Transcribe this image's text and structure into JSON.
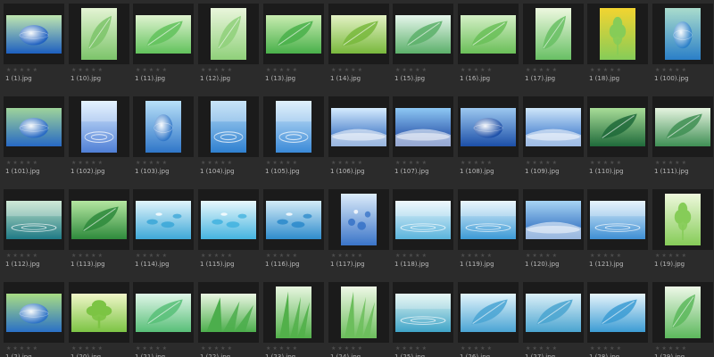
{
  "browser": {
    "thumbnails": [
      {
        "filename": "1 (1).jpg",
        "orientation": "landscape",
        "motif": "globe",
        "colors": [
          "#1d5fc0",
          "#bfe6b0"
        ]
      },
      {
        "filename": "1 (10).jpg",
        "orientation": "portrait",
        "motif": "leaf",
        "colors": [
          "#7cc46a",
          "#e4f4d4"
        ]
      },
      {
        "filename": "1 (11).jpg",
        "orientation": "landscape",
        "motif": "leaf",
        "colors": [
          "#62c25c",
          "#dff3d0"
        ]
      },
      {
        "filename": "1 (12).jpg",
        "orientation": "portrait",
        "motif": "leaf",
        "colors": [
          "#8fd07a",
          "#eaf6dc"
        ]
      },
      {
        "filename": "1 (13).jpg",
        "orientation": "landscape",
        "motif": "leaf",
        "colors": [
          "#49b04a",
          "#c8ecb0"
        ]
      },
      {
        "filename": "1 (14).jpg",
        "orientation": "landscape",
        "motif": "leaf",
        "colors": [
          "#78b83c",
          "#e3f2c4"
        ]
      },
      {
        "filename": "1 (15).jpg",
        "orientation": "landscape",
        "motif": "leaf",
        "colors": [
          "#5cb06a",
          "#e6f6ec"
        ]
      },
      {
        "filename": "1 (16).jpg",
        "orientation": "landscape",
        "motif": "leaf",
        "colors": [
          "#6abf58",
          "#d4efc6"
        ]
      },
      {
        "filename": "1 (17).jpg",
        "orientation": "portrait",
        "motif": "leaf",
        "colors": [
          "#68c064",
          "#eef8e0"
        ]
      },
      {
        "filename": "1 (18).jpg",
        "orientation": "portrait",
        "motif": "flower",
        "colors": [
          "#86cc58",
          "#f3d430"
        ]
      },
      {
        "filename": "1 (100).jpg",
        "orientation": "portrait",
        "motif": "globe",
        "colors": [
          "#2a7fc8",
          "#a9dccc"
        ]
      },
      {
        "filename": "1 (101).jpg",
        "orientation": "landscape",
        "motif": "globe",
        "colors": [
          "#2769c4",
          "#9ed39a"
        ]
      },
      {
        "filename": "1 (102).jpg",
        "orientation": "portrait",
        "motif": "water",
        "colors": [
          "#4f7fd6",
          "#dcefff"
        ]
      },
      {
        "filename": "1 (103).jpg",
        "orientation": "portrait",
        "motif": "globe",
        "colors": [
          "#2f76c8",
          "#b8e0f8"
        ]
      },
      {
        "filename": "1 (104).jpg",
        "orientation": "portrait",
        "motif": "water",
        "colors": [
          "#2f80d0",
          "#b6dcf6"
        ]
      },
      {
        "filename": "1 (105).jpg",
        "orientation": "portrait",
        "motif": "water",
        "colors": [
          "#3a8ad8",
          "#d6ecfb"
        ]
      },
      {
        "filename": "1 (106).jpg",
        "orientation": "landscape",
        "motif": "sky",
        "colors": [
          "#1f5db8",
          "#d6ecff"
        ]
      },
      {
        "filename": "1 (107).jpg",
        "orientation": "landscape",
        "motif": "sky",
        "colors": [
          "#153c9a",
          "#8ec8f4"
        ]
      },
      {
        "filename": "1 (108).jpg",
        "orientation": "landscape",
        "motif": "globe",
        "colors": [
          "#1c4fa8",
          "#9cc8f0"
        ]
      },
      {
        "filename": "1 (109).jpg",
        "orientation": "landscape",
        "motif": "sky",
        "colors": [
          "#2668c4",
          "#cfe6fa"
        ]
      },
      {
        "filename": "1 (110).jpg",
        "orientation": "landscape",
        "motif": "leaf",
        "colors": [
          "#1f6a3a",
          "#a8dc98"
        ]
      },
      {
        "filename": "1 (111).jpg",
        "orientation": "landscape",
        "motif": "leaf",
        "colors": [
          "#3f8f54",
          "#e6f4e0"
        ]
      },
      {
        "filename": "1 (112).jpg",
        "orientation": "landscape",
        "motif": "water",
        "colors": [
          "#1f7a86",
          "#bfe2c8"
        ]
      },
      {
        "filename": "1 (113).jpg",
        "orientation": "landscape",
        "motif": "leaf",
        "colors": [
          "#2e8a3c",
          "#b4e6a0"
        ]
      },
      {
        "filename": "1 (114).jpg",
        "orientation": "landscape",
        "motif": "drops",
        "colors": [
          "#3ea8d8",
          "#e0f4fb"
        ]
      },
      {
        "filename": "1 (115).jpg",
        "orientation": "landscape",
        "motif": "drops",
        "colors": [
          "#45b4e0",
          "#e8f8fc"
        ]
      },
      {
        "filename": "1 (116).jpg",
        "orientation": "landscape",
        "motif": "drops",
        "colors": [
          "#2f8ccc",
          "#d4ecf8"
        ]
      },
      {
        "filename": "1 (117).jpg",
        "orientation": "portrait",
        "motif": "drops",
        "colors": [
          "#3a74c8",
          "#dcecfa"
        ]
      },
      {
        "filename": "1 (118).jpg",
        "orientation": "landscape",
        "motif": "water",
        "colors": [
          "#5ab4dc",
          "#eaf6fc"
        ]
      },
      {
        "filename": "1 (119).jpg",
        "orientation": "landscape",
        "motif": "water",
        "colors": [
          "#3c9ad6",
          "#e2f2fb"
        ]
      },
      {
        "filename": "1 (120).jpg",
        "orientation": "landscape",
        "motif": "sky",
        "colors": [
          "#1d5fb8",
          "#a8d4f4"
        ]
      },
      {
        "filename": "1 (121).jpg",
        "orientation": "landscape",
        "motif": "water",
        "colors": [
          "#3e8fd4",
          "#dff0fb"
        ]
      },
      {
        "filename": "1 (19).jpg",
        "orientation": "portrait",
        "motif": "flower",
        "colors": [
          "#86cc58",
          "#eef8dc"
        ]
      },
      {
        "filename": "1 (2).jpg",
        "orientation": "landscape",
        "motif": "globe",
        "colors": [
          "#2a70c6",
          "#a8dc84"
        ]
      },
      {
        "filename": "1 (20).jpg",
        "orientation": "landscape",
        "motif": "flower",
        "colors": [
          "#7cc444",
          "#f0f6c8"
        ]
      },
      {
        "filename": "1 (21).jpg",
        "orientation": "landscape",
        "motif": "leaf",
        "colors": [
          "#58bf78",
          "#e0f6e8"
        ]
      },
      {
        "filename": "1 (22).jpg",
        "orientation": "landscape",
        "motif": "grass",
        "colors": [
          "#4cae4c",
          "#eaf6e2"
        ]
      },
      {
        "filename": "1 (23).jpg",
        "orientation": "portrait",
        "motif": "grass",
        "colors": [
          "#52b04a",
          "#e8f6e0"
        ]
      },
      {
        "filename": "1 (24).jpg",
        "orientation": "portrait",
        "motif": "grass",
        "colors": [
          "#6cbe5c",
          "#eef8e6"
        ]
      },
      {
        "filename": "1 (25).jpg",
        "orientation": "landscape",
        "motif": "water",
        "colors": [
          "#3fa4c8",
          "#dff4f0"
        ]
      },
      {
        "filename": "1 (26).jpg",
        "orientation": "landscape",
        "motif": "leaf",
        "colors": [
          "#4aa4d4",
          "#e2f4fb"
        ]
      },
      {
        "filename": "1 (27).jpg",
        "orientation": "landscape",
        "motif": "leaf",
        "colors": [
          "#4aa4d0",
          "#dcf0f8"
        ]
      },
      {
        "filename": "1 (28).jpg",
        "orientation": "landscape",
        "motif": "leaf",
        "colors": [
          "#3c9cd4",
          "#e6f4fb"
        ]
      },
      {
        "filename": "1 (29).jpg",
        "orientation": "portrait",
        "motif": "leaf",
        "colors": [
          "#5cb85c",
          "#eef8e8"
        ]
      }
    ]
  },
  "palette": {
    "background": "#2b2b2b",
    "frame": "#1b1b1b",
    "filename_text": "#b9b9b9",
    "star_empty": "#4e4e4e"
  },
  "rating_icon": "star-icon"
}
